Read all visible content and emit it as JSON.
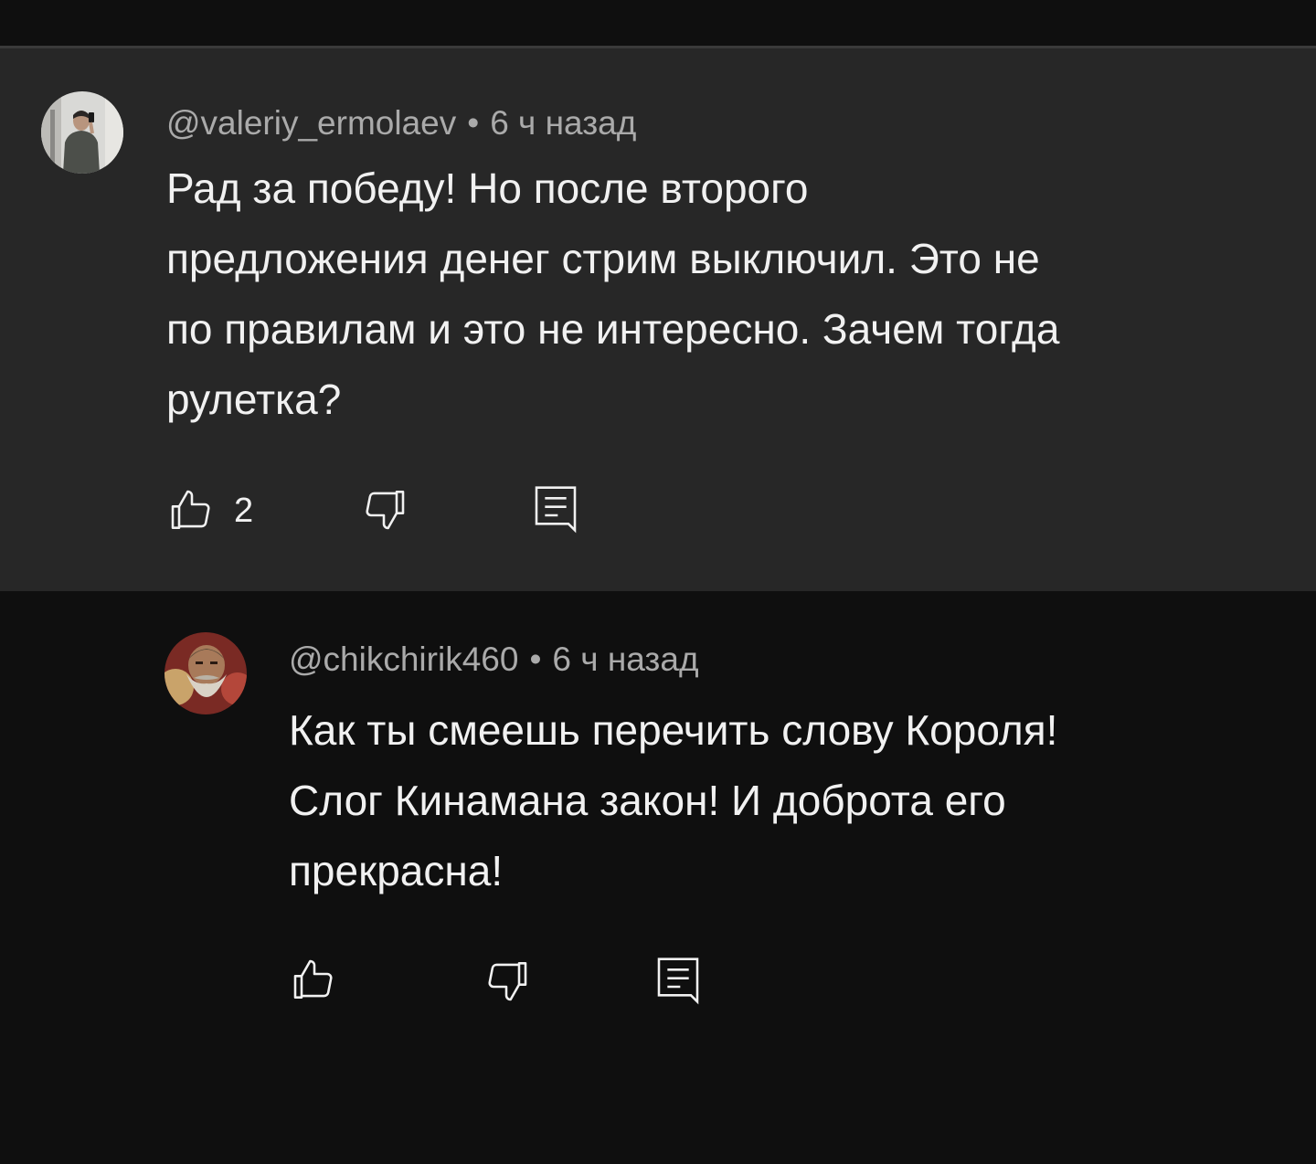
{
  "comments": [
    {
      "author": "@valeriy_ermolaev",
      "separator": "•",
      "time": "6 ч назад",
      "lines": [
        "Рад за победу! Но после второго",
        "предложения денег стрим выключил. Это не",
        "по правилам и это не интересно. Зачем тогда",
        "рулетка?"
      ],
      "likes": "2",
      "avatar_icon": "person-photo-avatar"
    },
    {
      "author": "@chikchirik460",
      "separator": "•",
      "time": "6 ч назад",
      "lines": [
        "Как ты смеешь перечить слову Короля!",
        "Слог Кинамана закон! И доброта его",
        "прекрасна!"
      ],
      "likes": "",
      "avatar_icon": "bearded-character-avatar"
    }
  ],
  "icons": {
    "like": "thumb-up-icon",
    "dislike": "thumb-down-icon",
    "reply": "reply-comment-icon"
  },
  "colors": {
    "background": "#0f0f0f",
    "highlight_background": "#272727",
    "meta_text": "#aaaaaa",
    "body_text": "#f1f1f1"
  }
}
